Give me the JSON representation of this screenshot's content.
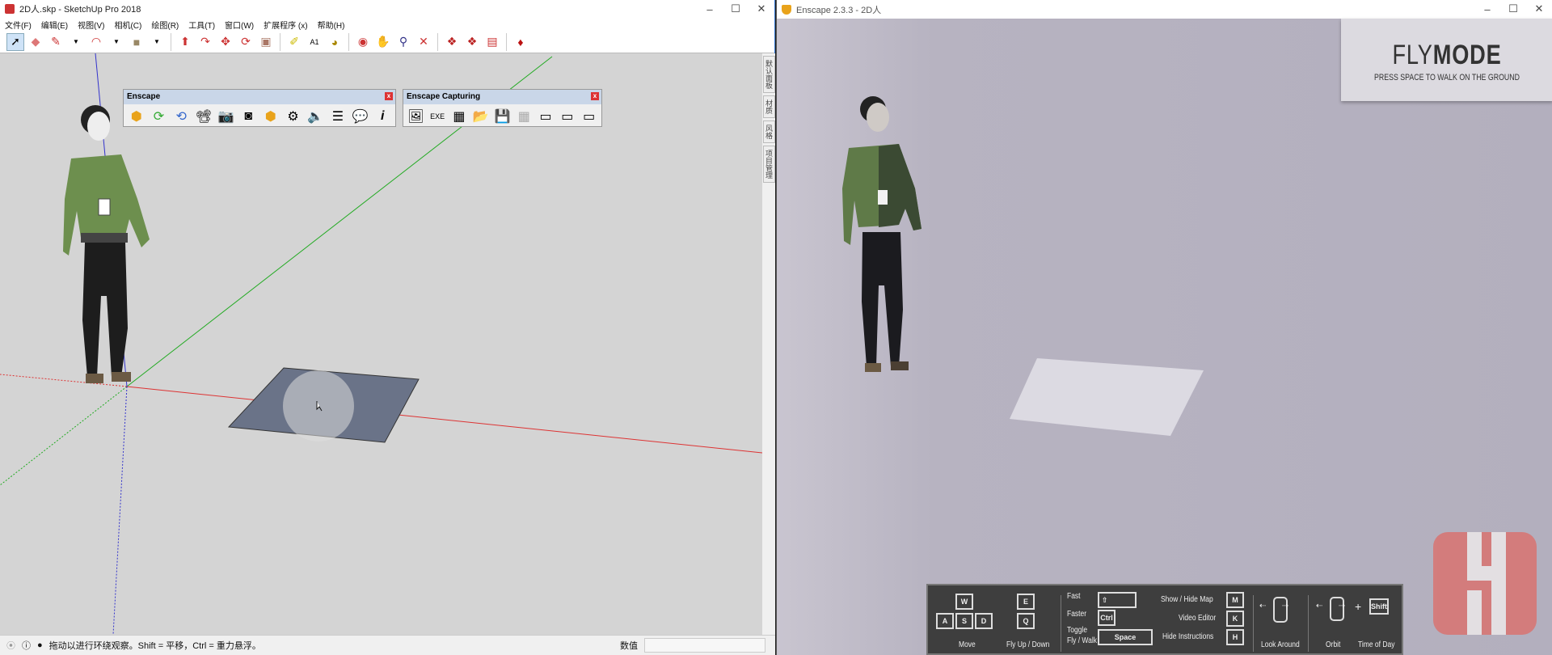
{
  "sketchup": {
    "title": "2D人.skp - SketchUp Pro 2018",
    "menu": [
      "文件(F)",
      "编辑(E)",
      "视图(V)",
      "相机(C)",
      "绘图(R)",
      "工具(T)",
      "窗口(W)",
      "扩展程序 (x)",
      "帮助(H)"
    ],
    "tray_tabs": [
      "默认面板",
      "材质",
      "风格",
      "项目管理"
    ],
    "enscape_toolbar": {
      "title": "Enscape",
      "close": "x"
    },
    "capturing_toolbar": {
      "title": "Enscape Capturing",
      "close": "x"
    },
    "status": {
      "message": "拖动以进行环绕观察。Shift = 平移，Ctrl = 重力悬浮。",
      "measure_label": "数值",
      "measure_value": ""
    },
    "axis_colors": {
      "red": "#d33",
      "green": "#2a2",
      "blue": "#33c"
    }
  },
  "enscape": {
    "title": "Enscape 2.3.3 - 2D人",
    "mode": {
      "light": "FLY",
      "bold": "MODE",
      "subtitle": "PRESS SPACE TO WALK ON THE GROUND"
    },
    "instructions": {
      "move": {
        "keys": [
          "W",
          "A",
          "S",
          "D"
        ],
        "label": "Move"
      },
      "fly": {
        "keys": [
          "E",
          "Q"
        ],
        "label": "Fly Up / Down"
      },
      "fast": {
        "label": "Fast",
        "key": "⇧"
      },
      "faster": {
        "label": "Faster",
        "key": "Ctrl"
      },
      "toggle": {
        "label1": "Toggle",
        "label2": "Fly / Walk",
        "key": "Space"
      },
      "map": {
        "label": "Show / Hide Map",
        "key": "M"
      },
      "video": {
        "label": "Video Editor",
        "key": "K"
      },
      "hide": {
        "label": "Hide Instructions",
        "key": "H"
      },
      "look": "Look Around",
      "orbit": "Orbit",
      "plus": "+",
      "shift": "Shift",
      "time": "Time of Day"
    },
    "logo_color": "#d57a79"
  }
}
